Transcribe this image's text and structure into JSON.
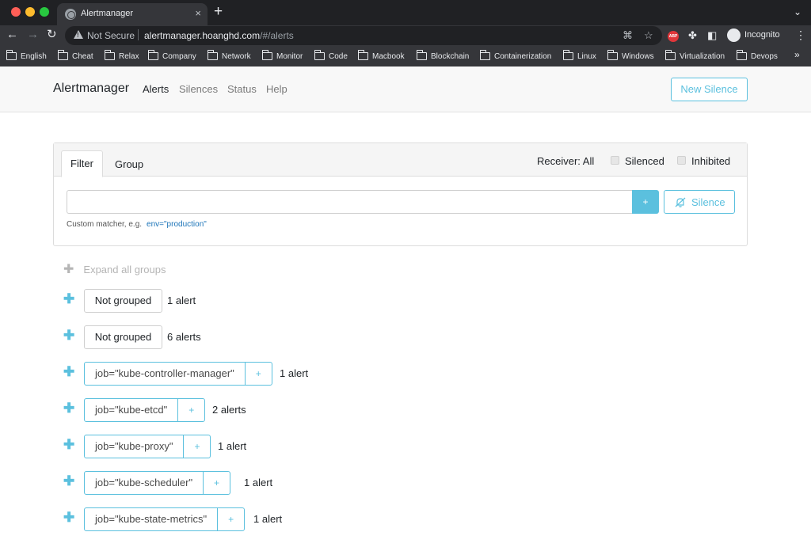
{
  "browser": {
    "tab_title": "Alertmanager",
    "tab_close": "×",
    "new_tab": "+",
    "tab_menu": "⌄",
    "not_secure": "Not Secure",
    "url_host": "alertmanager.hoanghd.com",
    "url_path": "/#/alerts",
    "profile_label": "Incognito",
    "abp_label": "ABP",
    "bookmarks": [
      "English",
      "Cheat",
      "Relax",
      "Company",
      "Network",
      "Monitor",
      "Code",
      "Macbook",
      "Blockchain",
      "Containerization",
      "Linux",
      "Windows",
      "Virtualization",
      "Devops"
    ],
    "bookmarks_more": "»"
  },
  "app": {
    "brand": "Alertmanager",
    "nav": [
      "Alerts",
      "Silences",
      "Status",
      "Help"
    ],
    "new_silence": "New Silence"
  },
  "filter": {
    "tabs": [
      "Filter",
      "Group"
    ],
    "receiver": "Receiver: All",
    "silenced": "Silenced",
    "inhibited": "Inhibited",
    "input_value": "",
    "add_label": "+",
    "silence_button": "Silence",
    "hint_prefix": "Custom matcher, e.g.",
    "hint_example": "env=\"production\""
  },
  "groups": {
    "expand_all": "Expand all groups",
    "items": [
      {
        "label": "Not grouped",
        "type": "plain",
        "count": "1 alert"
      },
      {
        "label": "Not grouped",
        "type": "plain",
        "count": "6 alerts"
      },
      {
        "label": "job=\"kube-controller-manager\"",
        "type": "job",
        "count": "1 alert"
      },
      {
        "label": "job=\"kube-etcd\"",
        "type": "job",
        "count": "2 alerts"
      },
      {
        "label": "job=\"kube-proxy\"",
        "type": "job",
        "count": "1 alert"
      },
      {
        "label": "job=\"kube-scheduler\"",
        "type": "job",
        "count": "1 alert"
      },
      {
        "label": "job=\"kube-state-metrics\"",
        "type": "job",
        "count": "1 alert"
      }
    ]
  },
  "colors": {
    "accent": "#5bc0de",
    "link": "#1a73b8"
  }
}
